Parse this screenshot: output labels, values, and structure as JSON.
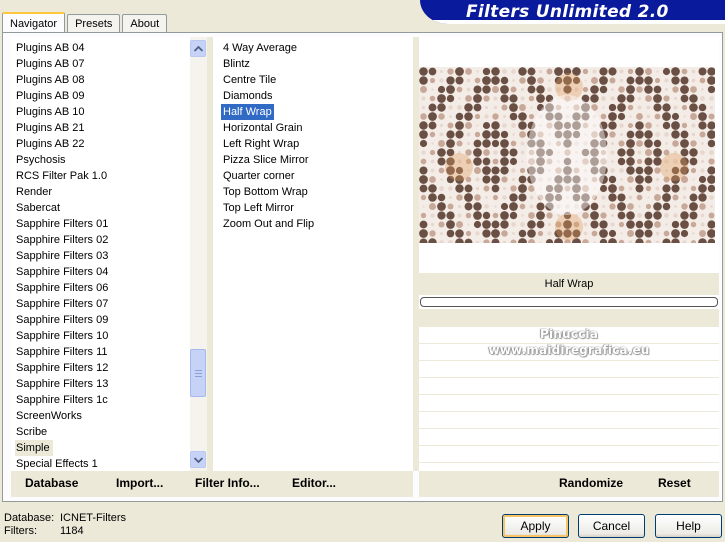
{
  "tabs": [
    {
      "label": "Navigator",
      "active": true
    },
    {
      "label": "Presets",
      "active": false
    },
    {
      "label": "About",
      "active": false
    }
  ],
  "title": "Filters Unlimited 2.0",
  "categories": [
    "Plugins AB 04",
    "Plugins AB 07",
    "Plugins AB 08",
    "Plugins AB 09",
    "Plugins AB 10",
    "Plugins AB 21",
    "Plugins AB 22",
    "Psychosis",
    "RCS Filter Pak 1.0",
    "Render",
    "Sabercat",
    "Sapphire Filters 01",
    "Sapphire Filters 02",
    "Sapphire Filters 03",
    "Sapphire Filters 04",
    "Sapphire Filters 06",
    "Sapphire Filters 07",
    "Sapphire Filters 09",
    "Sapphire Filters 10",
    "Sapphire Filters 11",
    "Sapphire Filters 12",
    "Sapphire Filters 13",
    "Sapphire Filters 1c",
    "ScreenWorks",
    "Scribe",
    "Simple",
    "Special Effects 1"
  ],
  "selected_category": "Simple",
  "filters": [
    "4 Way Average",
    "Blintz",
    "Centre Tile",
    "Diamonds",
    "Half Wrap",
    "Horizontal Grain",
    "Left Right Wrap",
    "Pizza Slice Mirror",
    "Quarter corner",
    "Top Bottom Wrap",
    "Top Left Mirror",
    "Zoom Out and Flip"
  ],
  "selected_filter": "Half Wrap",
  "preview": {
    "filter_name": "Half Wrap",
    "watermark_line1": "Pinuccia",
    "watermark_line2": "www.maidiregrafica.eu",
    "colors": {
      "light": "#f4ece6",
      "mid": "#c8a898",
      "dark": "#6a4f44",
      "accent": "#e09a5a"
    }
  },
  "commands": {
    "database": "Database",
    "import": "Import...",
    "filter_info": "Filter Info...",
    "editor": "Editor...",
    "randomize": "Randomize",
    "reset": "Reset"
  },
  "status": {
    "database_label": "Database:",
    "database_value": "ICNET-Filters",
    "filters_label": "Filters:",
    "filters_value": "1184"
  },
  "buttons": {
    "apply": "Apply",
    "cancel": "Cancel",
    "help": "Help"
  }
}
